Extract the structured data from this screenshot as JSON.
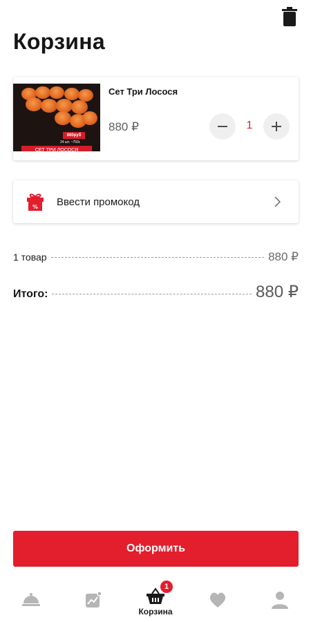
{
  "header": {
    "title": "Корзина",
    "delete_icon": "trash-icon"
  },
  "cart_item": {
    "name": "Сет Три Лосося",
    "price": "880 ₽",
    "quantity": "1",
    "image": {
      "price_tag": "880руб",
      "weight": "24 шт. ~750г.",
      "banner": "СЕТ ТРИ ЛОСОСЯ"
    }
  },
  "promo": {
    "label": "Ввести промокод",
    "icon": "gift-icon"
  },
  "summary": {
    "items_label": "1 товар",
    "items_value": "880 ₽",
    "total_label": "Итого:",
    "total_value": "880 ₽"
  },
  "checkout": {
    "label": "Оформить"
  },
  "tabbar": {
    "items": [
      {
        "name": "menu",
        "label": "",
        "icon": "cloche-icon"
      },
      {
        "name": "promotions",
        "label": "",
        "icon": "picture-icon"
      },
      {
        "name": "cart",
        "label": "Корзина",
        "icon": "basket-icon",
        "badge": "1"
      },
      {
        "name": "favorites",
        "label": "",
        "icon": "heart-icon"
      },
      {
        "name": "profile",
        "label": "",
        "icon": "user-icon"
      }
    ]
  },
  "colors": {
    "accent": "#e31e2d",
    "icon_inactive": "#b5b5b5",
    "text": "#1c1c1c"
  }
}
